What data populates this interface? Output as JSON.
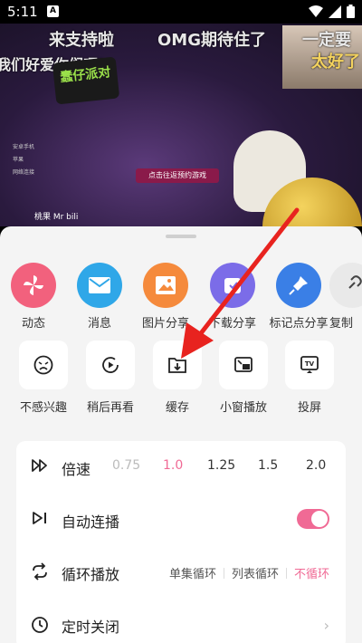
{
  "status": {
    "time": "5:11",
    "notification_icon": "A"
  },
  "video": {
    "danmaku": [
      "来支持啦",
      "OMG期待住了",
      "一定要",
      "我们好爱你们呀！",
      "太好了"
    ],
    "logo_text": "蠢仔派对",
    "cta": "点击往返预约游戏",
    "side_list": [
      "安卓手机",
      "苹果",
      "网络连接"
    ],
    "brand": "桃果 Mr bili"
  },
  "share_items": [
    {
      "label": "动态",
      "icon": "pinwheel-icon",
      "color": "#f2617d"
    },
    {
      "label": "消息",
      "icon": "envelope-icon",
      "color": "#2fa7e8"
    },
    {
      "label": "图片分享",
      "icon": "image-icon",
      "color": "#f58a3c"
    },
    {
      "label": "下载分享",
      "icon": "download-share-icon",
      "color": "#7b6ce8"
    },
    {
      "label": "标记点分享",
      "icon": "pin-icon",
      "color": "#3a7fe6"
    },
    {
      "label": "复制",
      "icon": "link-icon",
      "color": "#e9e9e9"
    }
  ],
  "action_items": [
    {
      "label": "不感兴趣",
      "icon": "frown-icon"
    },
    {
      "label": "稍后再看",
      "icon": "watch-later-icon"
    },
    {
      "label": "缓存",
      "icon": "cache-icon"
    },
    {
      "label": "小窗播放",
      "icon": "mini-window-icon"
    },
    {
      "label": "投屏",
      "icon": "tv-cast-icon"
    }
  ],
  "settings": {
    "speed": {
      "title": "倍速",
      "options": [
        "0.75",
        "1.0",
        "1.25",
        "1.5",
        "2.0"
      ],
      "selected": "1.0"
    },
    "autoplay": {
      "title": "自动连播",
      "on": true
    },
    "loop": {
      "title": "循环播放",
      "options": [
        "单集循环",
        "列表循环",
        "不循环"
      ],
      "selected": "不循环"
    },
    "timer": {
      "title": "定时关闭"
    }
  },
  "colors": {
    "accent": "#f06a95",
    "annotation_arrow": "#e8231f"
  }
}
